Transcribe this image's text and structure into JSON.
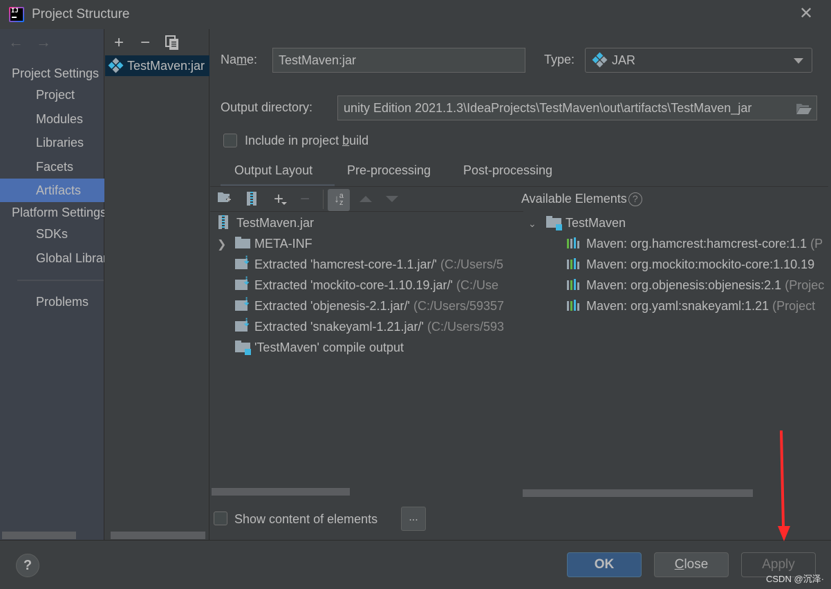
{
  "window": {
    "title": "Project Structure",
    "close_icon": "close-x-icon"
  },
  "sidebar": {
    "back_icon": "arrow-left-icon",
    "forward_icon": "arrow-right-icon",
    "project_settings_title": "Project Settings",
    "project_settings_items": [
      {
        "label": "Project",
        "selected": false
      },
      {
        "label": "Modules",
        "selected": false
      },
      {
        "label": "Libraries",
        "selected": false
      },
      {
        "label": "Facets",
        "selected": false
      },
      {
        "label": "Artifacts",
        "selected": true
      }
    ],
    "platform_settings_title": "Platform Settings",
    "platform_settings_items": [
      {
        "label": "SDKs"
      },
      {
        "label": "Global Libraries"
      }
    ],
    "problems_label": "Problems"
  },
  "artifacts_list": {
    "toolbar": {
      "add_icon": "plus-icon",
      "remove_icon": "minus-icon",
      "copy_icon": "copy-icon"
    },
    "items": [
      {
        "label": "TestMaven:jar",
        "icon": "artifact-diamond-icon",
        "selected": true
      }
    ]
  },
  "form": {
    "name_label": "Name:",
    "name_mnemonic": "m",
    "name_value": "TestMaven:jar",
    "type_label": "Type:",
    "type_value": "JAR",
    "output_dir_label": "Output directory:",
    "output_dir_value": "unity Edition 2021.1.3\\IdeaProjects\\TestMaven\\out\\artifacts\\TestMaven_jar",
    "include_build_label": "Include in project build",
    "include_build_checked": false
  },
  "tabs": [
    {
      "label": "Output Layout",
      "active": true
    },
    {
      "label": "Pre-processing",
      "active": false
    },
    {
      "label": "Post-processing",
      "active": false
    }
  ],
  "layout_toolbar": {
    "icons": [
      "new-folder-icon",
      "archive-icon",
      "add-dropdown-icon",
      "remove-icon",
      "sort-az-icon",
      "move-up-icon",
      "move-down-icon"
    ]
  },
  "output_tree": [
    {
      "label": "TestMaven.jar",
      "detail": "",
      "icon": "jar-icon",
      "indent": 0
    },
    {
      "label": "META-INF",
      "detail": "",
      "icon": "folder-icon",
      "indent": 1,
      "expandable": true
    },
    {
      "label": "Extracted 'hamcrest-core-1.1.jar/'",
      "detail": "(C:/Users/5",
      "icon": "extracted-icon",
      "indent": 1
    },
    {
      "label": "Extracted 'mockito-core-1.10.19.jar/'",
      "detail": "(C:/Use",
      "icon": "extracted-icon",
      "indent": 1
    },
    {
      "label": "Extracted 'objenesis-2.1.jar/'",
      "detail": "(C:/Users/59357",
      "icon": "extracted-icon",
      "indent": 1
    },
    {
      "label": "Extracted 'snakeyaml-1.21.jar/'",
      "detail": "(C:/Users/593",
      "icon": "extracted-icon",
      "indent": 1
    },
    {
      "label": "'TestMaven' compile output",
      "detail": "",
      "icon": "module-folder-icon",
      "indent": 1
    }
  ],
  "available_elements": {
    "title": "Available Elements",
    "help_icon": "help-circle-icon",
    "tree": [
      {
        "label": "TestMaven",
        "detail": "",
        "icon": "module-folder-icon",
        "expanded": true
      },
      {
        "label": "Maven: org.hamcrest:hamcrest-core:1.1",
        "detail": "(P",
        "icon": "library-icon"
      },
      {
        "label": "Maven: org.mockito:mockito-core:1.10.19",
        "detail": "",
        "icon": "library-icon"
      },
      {
        "label": "Maven: org.objenesis:objenesis:2.1",
        "detail": "(Projec",
        "icon": "library-icon"
      },
      {
        "label": "Maven: org.yaml:snakeyaml:1.21",
        "detail": "(Project",
        "icon": "library-icon"
      }
    ]
  },
  "show_content": {
    "label": "Show content of elements",
    "checked": false,
    "more_button": "..."
  },
  "footer": {
    "help_label": "?",
    "ok_label": "OK",
    "close_label": "Close",
    "close_mnemonic": "C",
    "apply_label": "Apply",
    "apply_enabled": false
  },
  "overlay": {
    "watermark": "CSDN @沉泽·",
    "annotation": "red-arrow-pointing-to-apply"
  },
  "colors": {
    "accent_selection": "#4b6eaf",
    "list_selection": "#0d293e",
    "ok_button": "#365880",
    "icon_blue": "#40b6e0",
    "annotation_red": "#ff2a2a"
  }
}
